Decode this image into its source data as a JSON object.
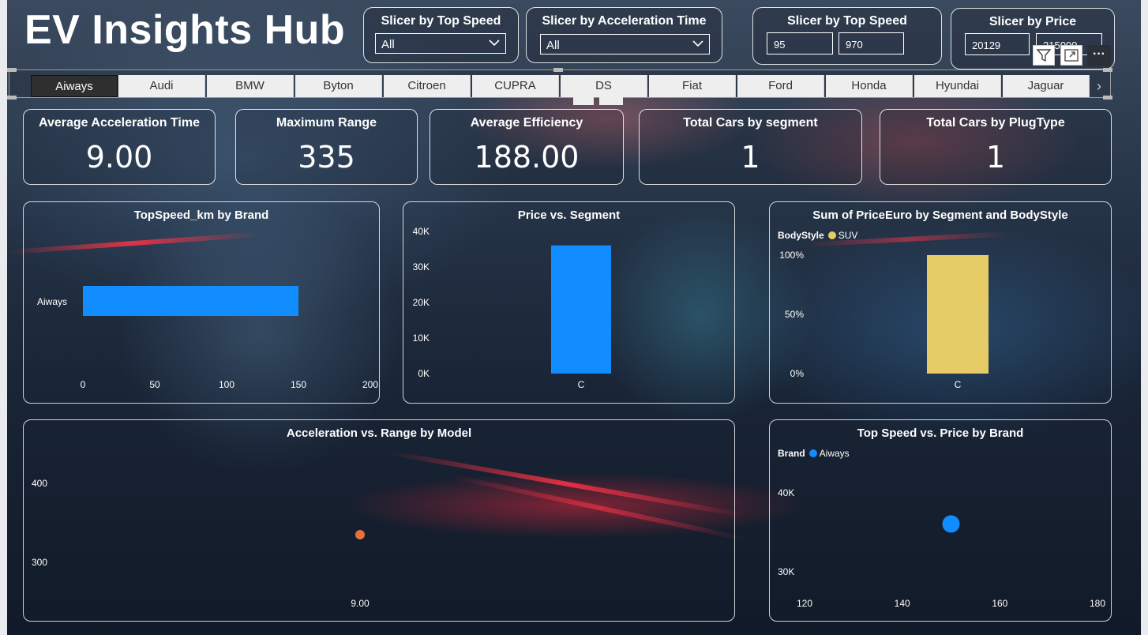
{
  "title": "EV Insights Hub",
  "slicers": {
    "top_speed_dropdown": {
      "title": "Slicer by Top Speed",
      "value": "All"
    },
    "acceleration_dropdown": {
      "title": "Slicer by Acceleration Time",
      "value": "All"
    },
    "top_speed_range": {
      "title": "Slicer by Top Speed",
      "min": "95",
      "max": "970"
    },
    "price_range": {
      "title": "Slicer by Price",
      "min": "20129",
      "max": "215000"
    }
  },
  "toolbar": {
    "filter_icon": "filter-icon",
    "focus_icon": "focus-mode-icon",
    "more_label": "···"
  },
  "brands": [
    "Aiways",
    "Audi",
    "BMW",
    "Byton",
    "Citroen",
    "CUPRA",
    "DS",
    "Fiat",
    "Ford",
    "Honda",
    "Hyundai",
    "Jaguar"
  ],
  "selected_brand": "Aiways",
  "kpis": [
    {
      "title": "Average Acceleration Time",
      "value": "9.00"
    },
    {
      "title": "Maximum Range",
      "value": "335"
    },
    {
      "title": "Average Efficiency",
      "value": "188.00"
    },
    {
      "title": "Total Cars by segment",
      "value": "1"
    },
    {
      "title": "Total Cars by PlugType",
      "value": "1"
    }
  ],
  "legends": {
    "bodystyle": {
      "label": "BodyStyle",
      "item": "SUV",
      "color": "#e6cc66"
    },
    "brand": {
      "label": "Brand",
      "item": "Aiways",
      "color": "#118dff"
    }
  },
  "chart_data": [
    {
      "type": "bar",
      "orientation": "horizontal",
      "title": "TopSpeed_km by Brand",
      "categories": [
        "Aiways"
      ],
      "values": [
        150
      ],
      "xlim": [
        0,
        200
      ],
      "xticks": [
        "0",
        "50",
        "100",
        "150",
        "200"
      ],
      "color": "#118dff"
    },
    {
      "type": "bar",
      "title": "Price vs. Segment",
      "categories": [
        "C"
      ],
      "values": [
        36057
      ],
      "ylim": [
        0,
        40000
      ],
      "yticks": [
        "0K",
        "10K",
        "20K",
        "30K",
        "40K"
      ],
      "color": "#118dff"
    },
    {
      "type": "bar",
      "stacked": "percent",
      "title": "Sum of PriceEuro by Segment and BodyStyle",
      "categories": [
        "C"
      ],
      "series": [
        {
          "name": "SUV",
          "values": [
            1.0
          ]
        }
      ],
      "ylim": [
        0,
        1
      ],
      "yticks": [
        "0%",
        "50%",
        "100%"
      ],
      "color": "#e6cc66"
    },
    {
      "type": "scatter",
      "title": "Acceleration vs. Range by Model",
      "points": [
        {
          "x": 9.0,
          "y": 335
        }
      ],
      "xticks": [
        "9.00"
      ],
      "yticks": [
        "300",
        "400"
      ],
      "ylim": [
        260,
        440
      ],
      "color": "#e8703a"
    },
    {
      "type": "scatter",
      "title": "Top Speed vs. Price by Brand",
      "points": [
        {
          "x": 150,
          "y": 36057
        }
      ],
      "xlim": [
        120,
        180
      ],
      "ylim": [
        27000,
        43000
      ],
      "xticks": [
        "120",
        "140",
        "160",
        "180"
      ],
      "yticks": [
        "30K",
        "40K"
      ],
      "color": "#118dff"
    }
  ]
}
